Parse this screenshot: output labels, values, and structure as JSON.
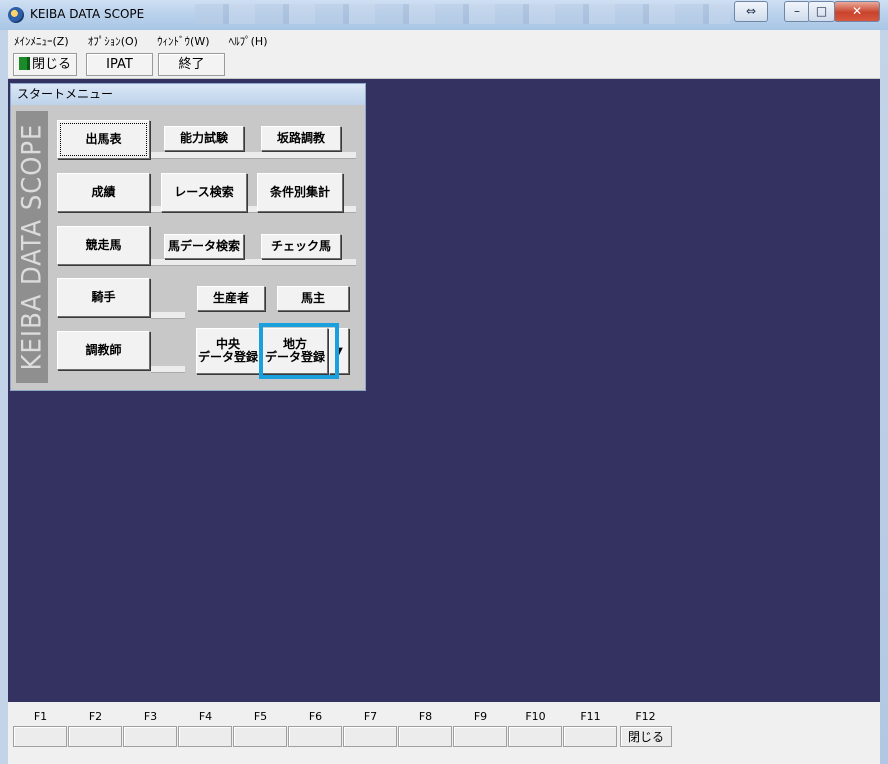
{
  "window": {
    "title": "KEIBA DATA SCOPE"
  },
  "menubar": [
    "ﾒｲﾝﾒﾆｭｰ(Z)",
    "ｵﾌﾟｼｮﾝ(O)",
    "ｳｨﾝﾄﾞｳ(W)",
    "ﾍﾙﾌﾟ(H)"
  ],
  "toolbar": {
    "close_label": "閉じる",
    "ipat_label": "IPAT",
    "exit_label": "終了"
  },
  "start_menu": {
    "title": "スタートメニュー",
    "side_logo": "KEIBA DATA SCOPE",
    "buttons": {
      "shutsuba": "出馬表",
      "noryoku": "能力試験",
      "hanro": "坂路調教",
      "seiseki": "成績",
      "race_search": "レース検索",
      "joken": "条件別集計",
      "kyosoba": "競走馬",
      "uma_search": "馬データ検索",
      "check_uma": "チェック馬",
      "kishu": "騎手",
      "seisansha": "生産者",
      "banushi": "馬主",
      "chokyoshi": "調教師",
      "chuo_line1": "中央",
      "chuo_line2": "データ登録",
      "chiho_line1": "地方",
      "chiho_line2": "データ登録"
    }
  },
  "fkeys": {
    "labels": [
      "F1",
      "F2",
      "F3",
      "F4",
      "F5",
      "F6",
      "F7",
      "F8",
      "F9",
      "F10",
      "F11",
      "F12"
    ],
    "f12_button": "閉じる"
  },
  "colors": {
    "workspace": "#343260",
    "highlight": "#1aa0dc"
  }
}
